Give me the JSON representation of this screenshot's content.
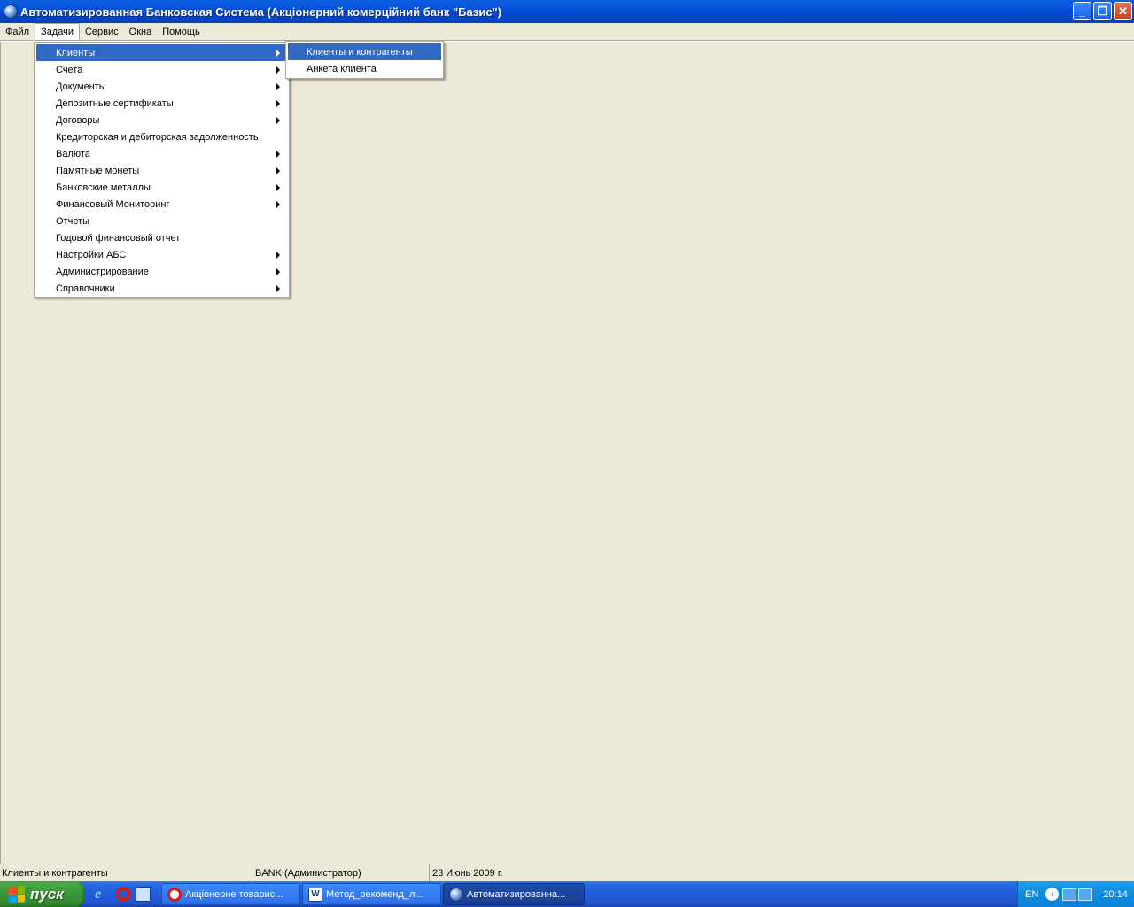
{
  "window": {
    "title": "Автоматизированная Банковская Система (Акціонерний комерційний банк \"Базис\")",
    "buttons": {
      "minimize": "_",
      "maximize": "❐",
      "close": "✕"
    }
  },
  "menubar": {
    "items": [
      {
        "label": "Файл"
      },
      {
        "label": "Задачи",
        "open": true
      },
      {
        "label": "Сервис"
      },
      {
        "label": "Окна"
      },
      {
        "label": "Помощь"
      }
    ]
  },
  "tasks_menu": {
    "items": [
      {
        "label": "Клиенты",
        "submenu": true,
        "highlighted": true
      },
      {
        "label": "Счета",
        "submenu": true
      },
      {
        "label": "Документы",
        "submenu": true
      },
      {
        "label": "Депозитные сертификаты",
        "submenu": true
      },
      {
        "label": "Договоры",
        "submenu": true
      },
      {
        "label": "Кредиторская и дебиторская задолженность",
        "submenu": false
      },
      {
        "label": "Валюта",
        "submenu": true
      },
      {
        "label": "Памятные монеты",
        "submenu": true
      },
      {
        "label": "Банковские металлы",
        "submenu": true
      },
      {
        "label": "Финансовый Мониторинг",
        "submenu": true
      },
      {
        "label": "Отчеты",
        "submenu": false
      },
      {
        "label": "Годовой финансовый отчет",
        "submenu": false
      },
      {
        "label": "Настройки АБС",
        "submenu": true
      },
      {
        "label": "Администрирование",
        "submenu": true
      },
      {
        "label": "Справочники",
        "submenu": true
      }
    ]
  },
  "clients_submenu": {
    "items": [
      {
        "label": "Клиенты и контрагенты",
        "highlighted": true
      },
      {
        "label": "Анкета клиента"
      }
    ]
  },
  "statusbar": {
    "hint": "Клиенты и контрагенты",
    "user": "BANK (Администратор)",
    "date": "23 Июнь 2009 г."
  },
  "taskbar": {
    "start_label": "пуск",
    "quick_launch": [
      {
        "icon": "internet-explorer-icon"
      },
      {
        "icon": "opera-icon"
      },
      {
        "icon": "show-desktop-icon"
      }
    ],
    "tasks": [
      {
        "label": "Акціонерне товарис...",
        "icon": "opera-icon",
        "active": false
      },
      {
        "label": "Метод_рекоменд_л...",
        "icon": "word-icon",
        "active": false
      },
      {
        "label": "Автоматизированна...",
        "icon": "globe-icon",
        "active": true
      }
    ],
    "tray": {
      "language": "EN",
      "clock": "20:14"
    }
  },
  "colors": {
    "titlebar": "#0147c8",
    "menu_highlight": "#316ac5",
    "window_bg": "#ece9d8",
    "taskbar": "#245edb",
    "start_button": "#3c9a38",
    "tray": "#0f8ee0"
  }
}
